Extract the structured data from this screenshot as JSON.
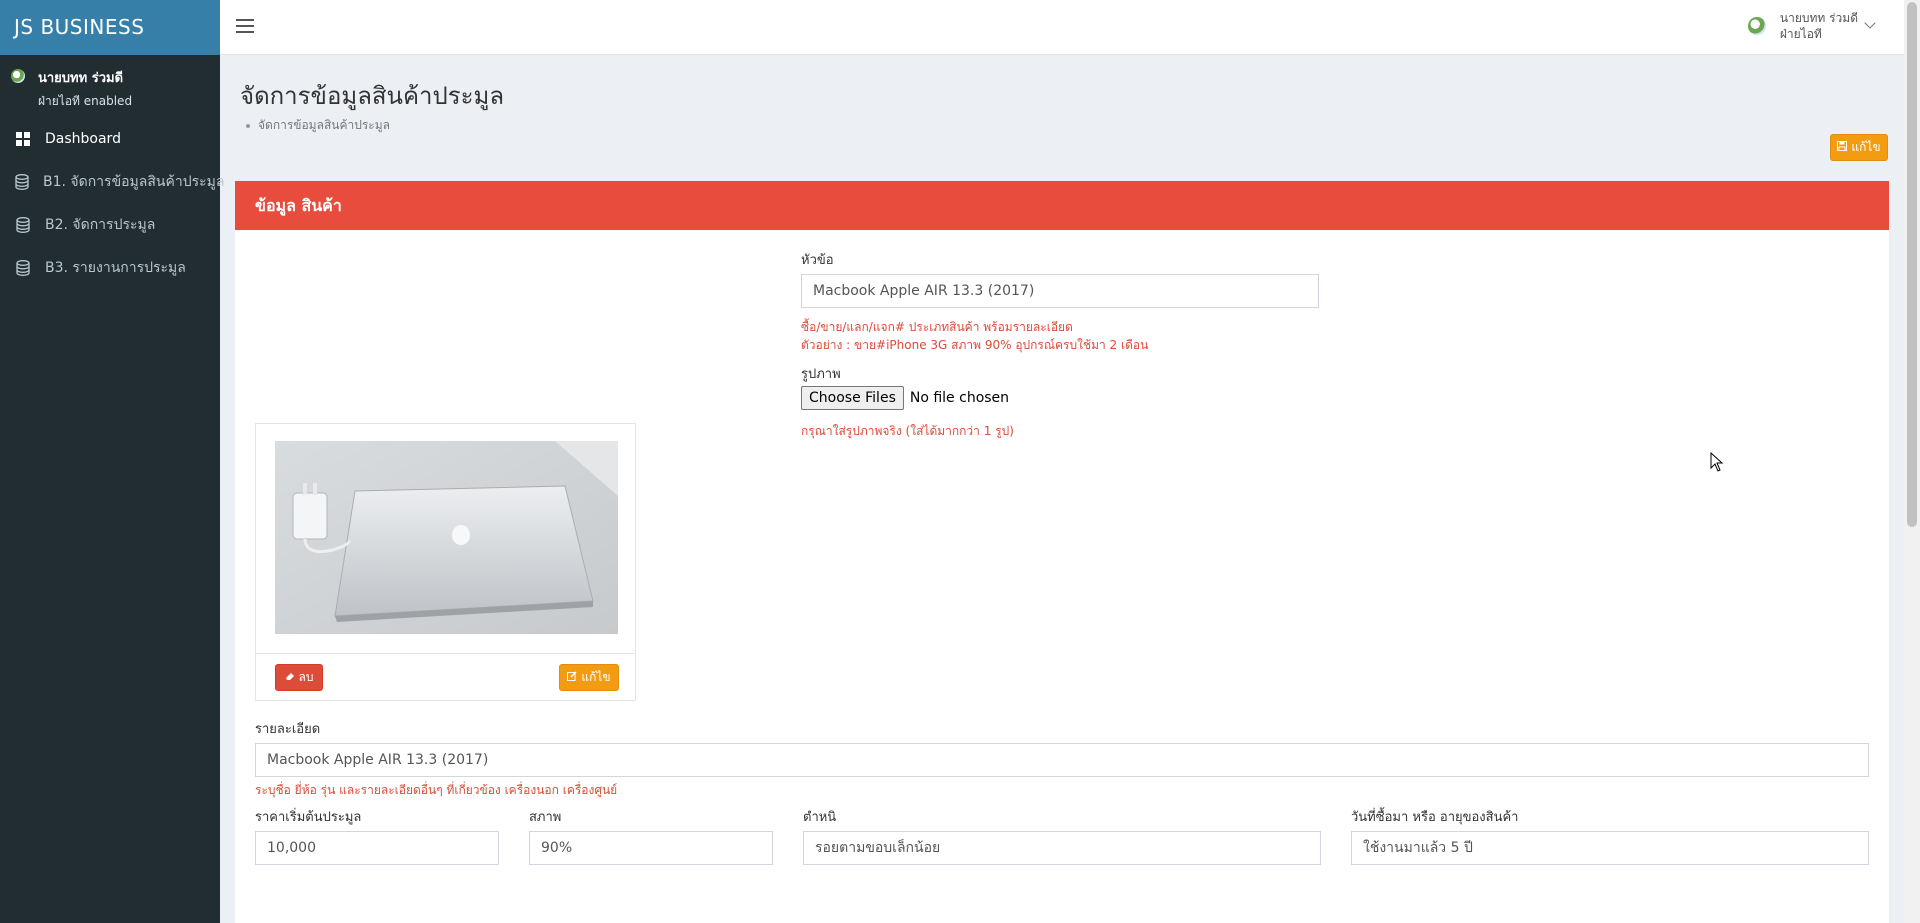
{
  "app": {
    "logo": "JS  BUSINESS"
  },
  "sidebar": {
    "user_name": "นายบทท ร่วมดี",
    "user_status": "ฝ่ายไอที enabled",
    "items": [
      {
        "label": "Dashboard",
        "icon": "dashboard-icon"
      },
      {
        "label": "B1. จัดการข้อมูลสินค้าประมูล",
        "icon": "database-icon"
      },
      {
        "label": "B2. จัดการประมูล",
        "icon": "database-icon"
      },
      {
        "label": "B3. รายงานการประมูล",
        "icon": "database-icon"
      }
    ]
  },
  "topbar": {
    "user_name": "นายบทท ร่วมดี",
    "user_dept": "ฝ่ายไอที"
  },
  "page": {
    "title": "จัดการข้อมูลสินค้าประมูล",
    "breadcrumb": "จัดการข้อมูลสินค้าประมูล",
    "edit_button": "แก้ไข"
  },
  "form": {
    "header": "ข้อมูล สินค้า",
    "subject_label": "หัวข้อ",
    "subject_value": "Macbook Apple AIR 13.3 (2017)",
    "subject_help1": "ซื้อ/ขาย/แลก/แจก# ประเภทสินค้า พร้อมรายละเอียด",
    "subject_help2": "ตัวอย่าง : ขาย#iPhone 3G สภาพ 90% อุปกรณ์ครบใช้มา 2 เดือน",
    "image_label": "รูปภาพ",
    "file_button": "Choose Files",
    "file_status": "No file chosen",
    "image_help": "กรุณาใส่รูปภาพจริง (ใส่ได้มากกว่า 1 รูป)",
    "delete_button": "ลบ",
    "edit_image_button": "แก้ไข",
    "detail_label": "รายละเอียด",
    "detail_value": "Macbook Apple AIR 13.3 (2017)",
    "detail_help": "ระบุชื่อ ยี่ห้อ รุ่น และรายละเอียดอื่นๆ ที่เกี่ยวข้อง เครื่องนอก เครื่องศูนย์",
    "price_label": "ราคาเริ่มต้นประมูล",
    "price_value": "10,000",
    "condition_label": "สภาพ",
    "condition_value": "90%",
    "defect_label": "ตำหนิ",
    "defect_value": "รอยตามขอบเล็กน้อย",
    "age_label": "วันที่ซื้อมา หรือ อายุของสินค้า",
    "age_value": "ใช้งานมาแล้ว 5 ปี"
  },
  "colors": {
    "sidebar_bg": "#222d32",
    "logo_bg": "#367fa9",
    "header_red": "#e74c3c",
    "warning": "#f39c12",
    "danger": "#dd4b39"
  }
}
